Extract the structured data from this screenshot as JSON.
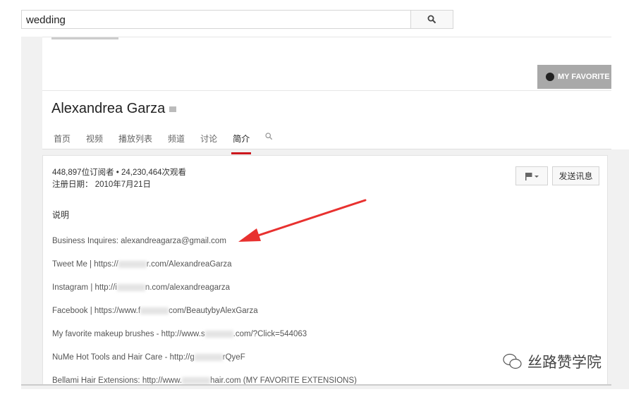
{
  "search": {
    "value": "wedding"
  },
  "banner": {
    "favorite_label": "MY FAVORITE"
  },
  "channel": {
    "name": "Alexandrea Garza"
  },
  "tabs": [
    {
      "label": "首页"
    },
    {
      "label": "视频"
    },
    {
      "label": "播放列表"
    },
    {
      "label": "频道"
    },
    {
      "label": "讨论"
    },
    {
      "label": "简介"
    }
  ],
  "about": {
    "stats": "448,897位订阅者 • 24,230,464次观看",
    "joined": "注册日期： 2010年7月21日",
    "send_message": "发送讯息",
    "desc_heading": "说明",
    "lines": [
      {
        "a": "Business Inquires: alexandreagarza@gmail.com",
        "b": ""
      },
      {
        "a": "Tweet Me | https://",
        "b": "r.com/AlexandreaGarza"
      },
      {
        "a": "Instagram | http://i",
        "b": "n.com/alexandreagarza"
      },
      {
        "a": "Facebook | https://www.f",
        "b": "com/BeautybyAlexGarza"
      },
      {
        "a": "My favorite makeup brushes - http://www.s",
        "b": ".com/?Click=544063"
      },
      {
        "a": "NuMe Hot Tools and Hair Care - http://g",
        "b": "rQyeF"
      },
      {
        "a": "Bellami Hair Extensions: http://www.",
        "b": "hair.com (MY FAVORITE EXTENSIONS)"
      }
    ]
  },
  "watermark": "丝路赞学院",
  "colors": {
    "accent": "#cc181e",
    "arrow": "#e8312f"
  }
}
